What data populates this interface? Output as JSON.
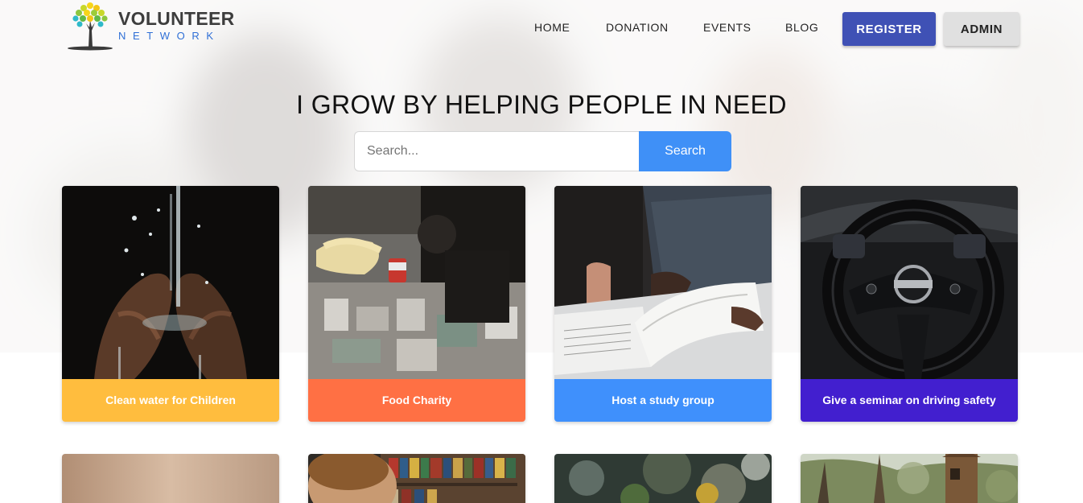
{
  "brand": {
    "title": "VOLUNTEER",
    "subtitle": "NETWORK"
  },
  "nav": {
    "items": [
      "HOME",
      "DONATION",
      "EVENTS",
      "BLOG"
    ],
    "register_label": "REGISTER",
    "admin_label": "ADMIN"
  },
  "hero": {
    "headline": "I GROW BY HELPING PEOPLE IN NEED"
  },
  "search": {
    "placeholder": "Search...",
    "button_label": "Search"
  },
  "events": [
    {
      "title": "Clean water for Children",
      "color": "#ffbd3e"
    },
    {
      "title": "Food Charity",
      "color": "#ff7044"
    },
    {
      "title": "Host a study group",
      "color": "#3f90fc"
    },
    {
      "title": "Give a seminar on driving safety",
      "color": "#421fcf"
    }
  ],
  "colors": {
    "primary_button": "#3f51b5",
    "search_button": "#3f90f7",
    "logo_accent": "#2f6fd6"
  }
}
